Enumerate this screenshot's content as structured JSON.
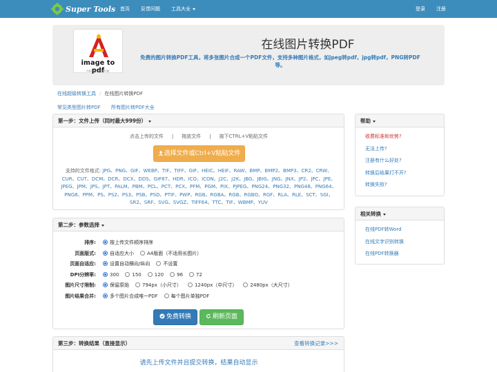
{
  "nav": {
    "brand": "Super Tools",
    "links": [
      "首页",
      "反馈问题",
      "工具大全"
    ],
    "login": "登录",
    "register": "注册"
  },
  "hero": {
    "logo_text": "image to pdf",
    "logo_sub": "support jpg/png/",
    "title": "在线图片转换PDF",
    "description": "免费的图片转换PDF工具，将多张图片合成一个PDF文件，支持多种图片格式，如jpeg转pdf，jpg转pdf，PNG转PDF等。"
  },
  "breadcrumb": {
    "parent": "在线超级转换工具",
    "current": "在线图片转换PDF"
  },
  "quick_links": [
    "常见类型图片转PDF",
    "所有图片转PDF大全"
  ],
  "step1": {
    "title": "第一步：文件上传（同时最大999份）",
    "hint_click": "点击上传的文件",
    "hint_drag": "拖放文件",
    "hint_paste": "按下CTRL+V粘贴文件",
    "separator": "|",
    "upload_label": "选择文件或Ctrl+V粘贴文件",
    "formats_prefix": "支持的文件格式:",
    "formats_list": "JPG、PNG、GIF、WEBP、TIF、TIFF、GIF、HEIC、HEIF、RAW、BMP、BMP2、BMP3、CR2、CRW、CUR、CUT、DCM、DCR、DCX、DDS、GIF87、HDR、ICO、ICON、J2C、J2K、JBG、JBIG、JNG、JNX、JP2、JPC、JPE、JPEG、JPM、JPS、JPT、PALM、PBM、PCL、PCT、PCX、PFM、PGM、PIX、PJPEG、PNG24、PNG32、PNG48、PNG64、PNG8、PPM、PS、PS2、PS3、PSB、PSD、PTIF、PWP、RGB、RGBA、RGB、RGBO、RGF、RLA、RLE、SCT、SGI、SR2、SRF、SVG、SVGZ、TIFF64、TTC、TIF、WBMP、YUV"
  },
  "step2": {
    "title": "第二步：参数选择",
    "options": [
      {
        "label": "排序:",
        "choices": [
          "按上传文件顺序排序"
        ],
        "selected": 0
      },
      {
        "label": "页面版式:",
        "choices": [
          "自适应大小",
          "A4版面（不适用长图片）"
        ],
        "selected": 0
      },
      {
        "label": "页面自适应:",
        "choices": [
          "设置自动横向/纵向",
          "不设置"
        ],
        "selected": 0
      },
      {
        "label": "DPI分辨率:",
        "choices": [
          "300",
          "150",
          "120",
          "96",
          "72"
        ],
        "selected": 0
      },
      {
        "label": "图片尺寸限制:",
        "choices": [
          "保留原始",
          "794px（小尺寸）",
          "1240px（中尺寸）",
          "2480px（大尺寸）"
        ],
        "selected": 0
      },
      {
        "label": "图片结果合并:",
        "choices": [
          "多个图片合成唯一PDF",
          "每个图片单独PDF"
        ],
        "selected": 0
      }
    ],
    "convert_label": "免费转换",
    "refresh_label": "刷新页面"
  },
  "step3": {
    "title": "第三步：转换结果（直接显示）",
    "history_link": "查看转换记录>>>",
    "message": "请先上传文件并且提交转换，结果自动显示"
  },
  "help": {
    "title": "帮助",
    "items": [
      "收费标准和优势?",
      "无法上传?",
      "注册有什么好处?",
      "转换后结果打不开?",
      "转换失败?"
    ]
  },
  "related": {
    "title": "相关转换",
    "items": [
      "在线PDF转Word",
      "在线文字识别转换",
      "在线PDF转换器"
    ]
  },
  "colors": {
    "navbar": "#3c8dbc",
    "link": "#337ab7",
    "upload": "#f0ad4e",
    "convert": "#337ab7",
    "refresh": "#5cb85c",
    "help_first": "#c9302c"
  }
}
